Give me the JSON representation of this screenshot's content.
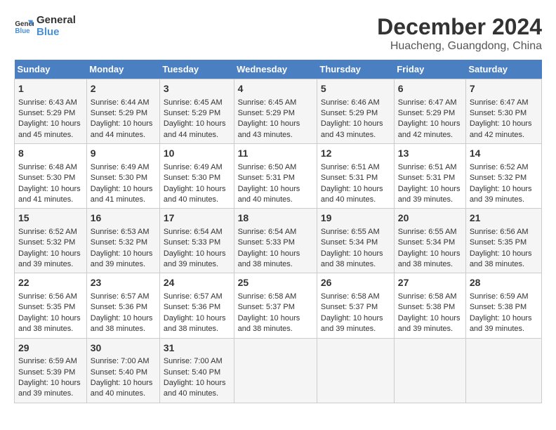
{
  "logo": {
    "line1": "General",
    "line2": "Blue"
  },
  "title": "December 2024",
  "subtitle": "Huacheng, Guangdong, China",
  "days_of_week": [
    "Sunday",
    "Monday",
    "Tuesday",
    "Wednesday",
    "Thursday",
    "Friday",
    "Saturday"
  ],
  "weeks": [
    [
      {
        "day": "1",
        "sunrise": "Sunrise: 6:43 AM",
        "sunset": "Sunset: 5:29 PM",
        "daylight": "Daylight: 10 hours and 45 minutes."
      },
      {
        "day": "2",
        "sunrise": "Sunrise: 6:44 AM",
        "sunset": "Sunset: 5:29 PM",
        "daylight": "Daylight: 10 hours and 44 minutes."
      },
      {
        "day": "3",
        "sunrise": "Sunrise: 6:45 AM",
        "sunset": "Sunset: 5:29 PM",
        "daylight": "Daylight: 10 hours and 44 minutes."
      },
      {
        "day": "4",
        "sunrise": "Sunrise: 6:45 AM",
        "sunset": "Sunset: 5:29 PM",
        "daylight": "Daylight: 10 hours and 43 minutes."
      },
      {
        "day": "5",
        "sunrise": "Sunrise: 6:46 AM",
        "sunset": "Sunset: 5:29 PM",
        "daylight": "Daylight: 10 hours and 43 minutes."
      },
      {
        "day": "6",
        "sunrise": "Sunrise: 6:47 AM",
        "sunset": "Sunset: 5:29 PM",
        "daylight": "Daylight: 10 hours and 42 minutes."
      },
      {
        "day": "7",
        "sunrise": "Sunrise: 6:47 AM",
        "sunset": "Sunset: 5:30 PM",
        "daylight": "Daylight: 10 hours and 42 minutes."
      }
    ],
    [
      {
        "day": "8",
        "sunrise": "Sunrise: 6:48 AM",
        "sunset": "Sunset: 5:30 PM",
        "daylight": "Daylight: 10 hours and 41 minutes."
      },
      {
        "day": "9",
        "sunrise": "Sunrise: 6:49 AM",
        "sunset": "Sunset: 5:30 PM",
        "daylight": "Daylight: 10 hours and 41 minutes."
      },
      {
        "day": "10",
        "sunrise": "Sunrise: 6:49 AM",
        "sunset": "Sunset: 5:30 PM",
        "daylight": "Daylight: 10 hours and 40 minutes."
      },
      {
        "day": "11",
        "sunrise": "Sunrise: 6:50 AM",
        "sunset": "Sunset: 5:31 PM",
        "daylight": "Daylight: 10 hours and 40 minutes."
      },
      {
        "day": "12",
        "sunrise": "Sunrise: 6:51 AM",
        "sunset": "Sunset: 5:31 PM",
        "daylight": "Daylight: 10 hours and 40 minutes."
      },
      {
        "day": "13",
        "sunrise": "Sunrise: 6:51 AM",
        "sunset": "Sunset: 5:31 PM",
        "daylight": "Daylight: 10 hours and 39 minutes."
      },
      {
        "day": "14",
        "sunrise": "Sunrise: 6:52 AM",
        "sunset": "Sunset: 5:32 PM",
        "daylight": "Daylight: 10 hours and 39 minutes."
      }
    ],
    [
      {
        "day": "15",
        "sunrise": "Sunrise: 6:52 AM",
        "sunset": "Sunset: 5:32 PM",
        "daylight": "Daylight: 10 hours and 39 minutes."
      },
      {
        "day": "16",
        "sunrise": "Sunrise: 6:53 AM",
        "sunset": "Sunset: 5:32 PM",
        "daylight": "Daylight: 10 hours and 39 minutes."
      },
      {
        "day": "17",
        "sunrise": "Sunrise: 6:54 AM",
        "sunset": "Sunset: 5:33 PM",
        "daylight": "Daylight: 10 hours and 39 minutes."
      },
      {
        "day": "18",
        "sunrise": "Sunrise: 6:54 AM",
        "sunset": "Sunset: 5:33 PM",
        "daylight": "Daylight: 10 hours and 38 minutes."
      },
      {
        "day": "19",
        "sunrise": "Sunrise: 6:55 AM",
        "sunset": "Sunset: 5:34 PM",
        "daylight": "Daylight: 10 hours and 38 minutes."
      },
      {
        "day": "20",
        "sunrise": "Sunrise: 6:55 AM",
        "sunset": "Sunset: 5:34 PM",
        "daylight": "Daylight: 10 hours and 38 minutes."
      },
      {
        "day": "21",
        "sunrise": "Sunrise: 6:56 AM",
        "sunset": "Sunset: 5:35 PM",
        "daylight": "Daylight: 10 hours and 38 minutes."
      }
    ],
    [
      {
        "day": "22",
        "sunrise": "Sunrise: 6:56 AM",
        "sunset": "Sunset: 5:35 PM",
        "daylight": "Daylight: 10 hours and 38 minutes."
      },
      {
        "day": "23",
        "sunrise": "Sunrise: 6:57 AM",
        "sunset": "Sunset: 5:36 PM",
        "daylight": "Daylight: 10 hours and 38 minutes."
      },
      {
        "day": "24",
        "sunrise": "Sunrise: 6:57 AM",
        "sunset": "Sunset: 5:36 PM",
        "daylight": "Daylight: 10 hours and 38 minutes."
      },
      {
        "day": "25",
        "sunrise": "Sunrise: 6:58 AM",
        "sunset": "Sunset: 5:37 PM",
        "daylight": "Daylight: 10 hours and 38 minutes."
      },
      {
        "day": "26",
        "sunrise": "Sunrise: 6:58 AM",
        "sunset": "Sunset: 5:37 PM",
        "daylight": "Daylight: 10 hours and 39 minutes."
      },
      {
        "day": "27",
        "sunrise": "Sunrise: 6:58 AM",
        "sunset": "Sunset: 5:38 PM",
        "daylight": "Daylight: 10 hours and 39 minutes."
      },
      {
        "day": "28",
        "sunrise": "Sunrise: 6:59 AM",
        "sunset": "Sunset: 5:38 PM",
        "daylight": "Daylight: 10 hours and 39 minutes."
      }
    ],
    [
      {
        "day": "29",
        "sunrise": "Sunrise: 6:59 AM",
        "sunset": "Sunset: 5:39 PM",
        "daylight": "Daylight: 10 hours and 39 minutes."
      },
      {
        "day": "30",
        "sunrise": "Sunrise: 7:00 AM",
        "sunset": "Sunset: 5:40 PM",
        "daylight": "Daylight: 10 hours and 40 minutes."
      },
      {
        "day": "31",
        "sunrise": "Sunrise: 7:00 AM",
        "sunset": "Sunset: 5:40 PM",
        "daylight": "Daylight: 10 hours and 40 minutes."
      },
      null,
      null,
      null,
      null
    ]
  ]
}
